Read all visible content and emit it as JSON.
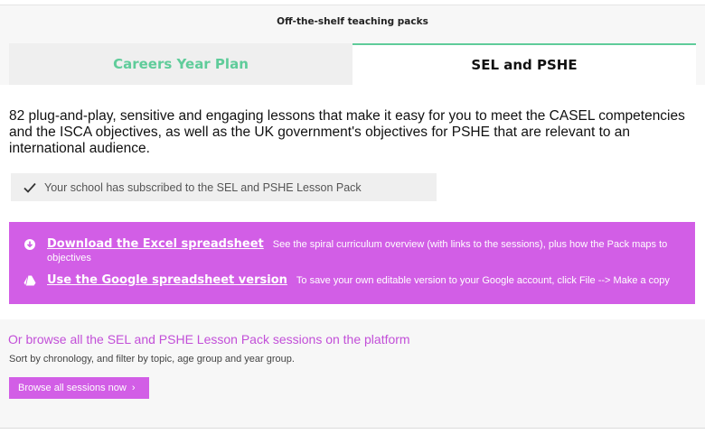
{
  "header": {
    "title": "Off-the-shelf teaching packs"
  },
  "tabs": [
    {
      "label": "Careers Year Plan",
      "active": false
    },
    {
      "label": "SEL and PSHE",
      "active": true
    }
  ],
  "intro": "82 plug-and-play, sensitive and engaging lessons that make it easy for you to meet the CASEL competencies and the ISCA objectives, as well as the UK government's objectives for PSHE that are relevant to an international audience.",
  "notice": {
    "icon": "checkmark-icon",
    "text": "Your school has subscribed to the SEL and PSHE Lesson Pack"
  },
  "panel": {
    "background": "#d25ee6",
    "excel": {
      "icon": "download-circle-icon",
      "link": "Download the Excel spreadsheet",
      "description": "See the spiral curriculum overview (with links to the sessions), plus how the Pack maps to objectives"
    },
    "google": {
      "icon": "google-drive-icon",
      "link": "Use the Google spreadsheet version",
      "description": "To save your own editable version to your Google account, click File --> Make a copy"
    }
  },
  "browse": {
    "heading": "Or browse all the SEL and PSHE Lesson Pack sessions on the platform",
    "subtitle": "Sort by chronology, and filter by topic, age group and year group.",
    "button": "Browse all sessions now",
    "button_icon": "chevron-right-icon"
  },
  "colors": {
    "accent_green": "#5fcc9a",
    "accent_purple": "#d25ee6",
    "heading_purple": "#c24fd8"
  }
}
